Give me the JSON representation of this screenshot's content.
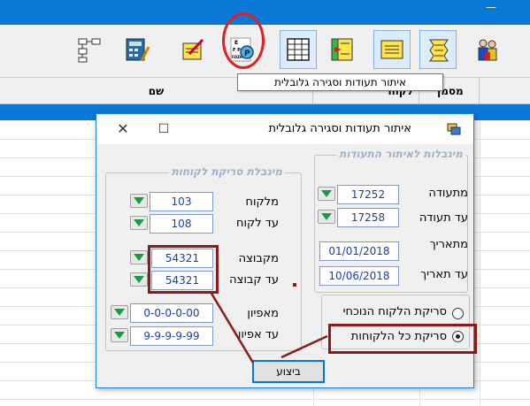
{
  "app": {
    "minimize_glyph": "—"
  },
  "toolbar": {
    "icons": [
      "hierarchy-icon",
      "calculator-icon",
      "invoice-icon",
      "eye-chart-icon",
      "spreadsheet-icon",
      "document-arrow-icon",
      "yellow-form-icon",
      "zigzag-form-icon",
      "users-icon"
    ],
    "tooltip": "איתור תעודות וסגירה גלובלית"
  },
  "grid": {
    "columns": [
      "שם",
      "לקוח",
      "מסמך"
    ]
  },
  "dialog": {
    "title": "איתור תעודות וסגירה גלובלית",
    "close_glyph": "✕",
    "maximize_glyph": "☐",
    "doc_group": {
      "title": "מיגבלות לאיתור התעודות",
      "from_doc_label": "מתעודה",
      "from_doc_value": "17252",
      "to_doc_label": "עד תעודה",
      "to_doc_value": "17258",
      "from_date_label": "מתאריך",
      "from_date_value": "01/01/2018",
      "to_date_label": "עד תאריך",
      "to_date_value": "10/06/2018"
    },
    "customer_group": {
      "title": "מיגבלת סריקת לקוחות",
      "from_customer_label": "מלקוח",
      "from_customer_value": "103",
      "to_customer_label": "עד לקוח",
      "to_customer_value": "108",
      "from_group_label": "מקבוצה",
      "from_group_value": "54321",
      "to_group_label": "עד קבוצה",
      "to_group_value": "54321",
      "from_attr_label": "מאפיון",
      "from_attr_value": "0-0-0-0-00",
      "to_attr_label": "עד אפיון",
      "to_attr_value": "9-9-9-9-99"
    },
    "scan_options": {
      "current_label": "סריקת הלקוח הנוכחי",
      "all_label": "סריקת כל הלקוחות",
      "selected": "all"
    },
    "run_label": "ביצוע"
  },
  "colors": {
    "titlebar": "#0a78d7",
    "selection": "#0a78d7",
    "annotation_red": "#e02020",
    "annotation_dark": "#8b1a1a",
    "field_text": "#1a3ea8",
    "group_title": "#9fb0c8"
  }
}
